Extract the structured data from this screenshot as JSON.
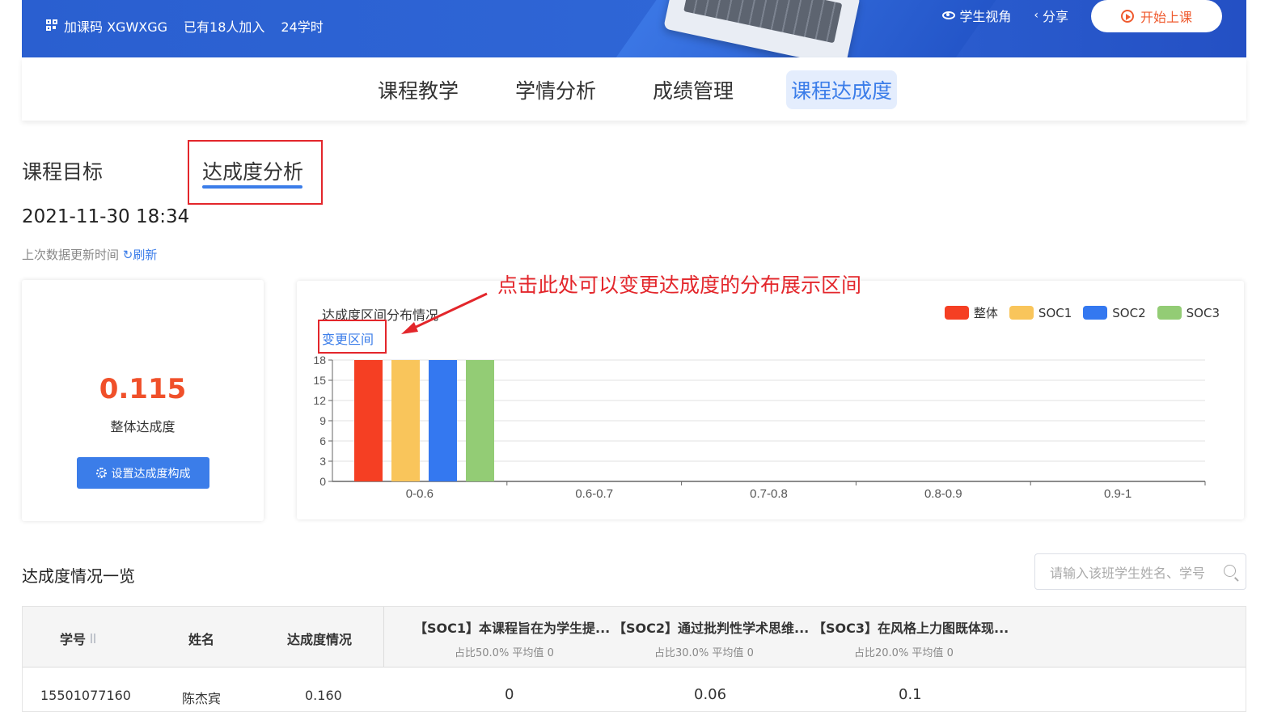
{
  "banner": {
    "course_code": "加课码 XGWXGG",
    "joined": "已有18人加入",
    "hours": "24学时",
    "student_view": "学生视角",
    "share": "分享",
    "start_class": "开始上课"
  },
  "tabs": [
    {
      "label": "课程教学"
    },
    {
      "label": "学情分析"
    },
    {
      "label": "成绩管理"
    },
    {
      "label": "课程达成度",
      "active": true
    }
  ],
  "subtabs": {
    "goal": "课程目标",
    "analysis": "达成度分析"
  },
  "datetime": "2021-11-30 18:34",
  "update": {
    "label": "上次数据更新时间",
    "refresh": "刷新"
  },
  "overall": {
    "value": "0.115",
    "label": "整体达成度",
    "button": "设置达成度构成"
  },
  "annotation": "点击此处可以变更达成度的分布展示区间",
  "chart_panel": {
    "title": "达成度区间分布情况",
    "change_range": "变更区间"
  },
  "chart_data": {
    "type": "bar",
    "title": "达成度区间分布情况",
    "categories": [
      "0-0.6",
      "0.6-0.7",
      "0.7-0.8",
      "0.8-0.9",
      "0.9-1"
    ],
    "series": [
      {
        "name": "整体",
        "color": "#f53f23",
        "values": [
          18,
          0,
          0,
          0,
          0
        ]
      },
      {
        "name": "SOC1",
        "color": "#f9c55b",
        "values": [
          18,
          0,
          0,
          0,
          0
        ]
      },
      {
        "name": "SOC2",
        "color": "#3478f0",
        "values": [
          18,
          0,
          0,
          0,
          0
        ]
      },
      {
        "name": "SOC3",
        "color": "#93cc75",
        "values": [
          18,
          0,
          0,
          0,
          0
        ]
      }
    ],
    "yticks": [
      0,
      3,
      6,
      9,
      12,
      15,
      18
    ],
    "ylim": [
      0,
      18
    ],
    "grid": true,
    "legend": "top-right"
  },
  "section": {
    "title": "达成度情况一览",
    "search_placeholder": "请输入该班学生姓名、学号"
  },
  "table": {
    "headers": {
      "id": "学号",
      "name": "姓名",
      "status": "达成度情况",
      "soc1": "【SOC1】本课程旨在为学生提...",
      "soc2": "【SOC2】通过批判性学术思维...",
      "soc3": "【SOC3】在风格上力图既体现...",
      "soc1_sub": "占比50.0%   平均值 0",
      "soc2_sub": "占比30.0%   平均值 0",
      "soc3_sub": "占比20.0%   平均值 0"
    },
    "rows": [
      {
        "id": "15501077160",
        "name": "陈杰宾",
        "status": "0.160",
        "soc1": "0",
        "soc2": "0.06",
        "soc3": "0.1"
      }
    ]
  }
}
